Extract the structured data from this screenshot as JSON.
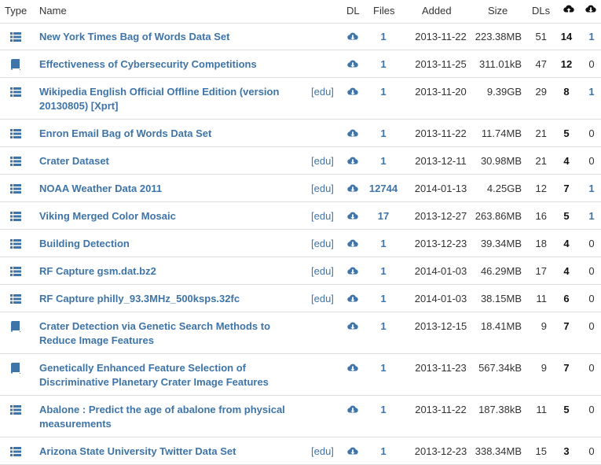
{
  "header": {
    "type": "Type",
    "name": "Name",
    "dl": "DL",
    "files": "Files",
    "added": "Added",
    "size": "Size",
    "dls": "DLs",
    "seeders_icon": "cloud-upload-icon",
    "leechers_icon": "cloud-download-icon"
  },
  "colors": {
    "link": "#3e74a8",
    "border": "#dddddd",
    "text": "#333333"
  },
  "rows": [
    {
      "type": "dataset",
      "name": "New York Times Bag of Words Data Set",
      "edu": "",
      "files": "1",
      "added": "2013-11-22",
      "size": "223.38MB",
      "dls": "51",
      "seeders": "14",
      "leechers": "1"
    },
    {
      "type": "paper",
      "name": "Effectiveness of Cybersecurity Competitions",
      "edu": "",
      "files": "1",
      "added": "2013-11-25",
      "size": "311.01kB",
      "dls": "47",
      "seeders": "12",
      "leechers": "0"
    },
    {
      "type": "dataset",
      "name": "Wikipedia English Official Offline Edition (version 20130805) [Xprt]",
      "edu": "[edu]",
      "files": "1",
      "added": "2013-11-20",
      "size": "9.39GB",
      "dls": "29",
      "seeders": "8",
      "leechers": "1"
    },
    {
      "type": "dataset",
      "name": "Enron Email Bag of Words Data Set",
      "edu": "",
      "files": "1",
      "added": "2013-11-22",
      "size": "11.74MB",
      "dls": "21",
      "seeders": "5",
      "leechers": "0"
    },
    {
      "type": "dataset",
      "name": "Crater Dataset",
      "edu": "[edu]",
      "files": "1",
      "added": "2013-12-11",
      "size": "30.98MB",
      "dls": "21",
      "seeders": "4",
      "leechers": "0"
    },
    {
      "type": "dataset",
      "name": "NOAA Weather Data 2011",
      "edu": "[edu]",
      "files": "12744",
      "added": "2014-01-13",
      "size": "4.25GB",
      "dls": "12",
      "seeders": "7",
      "leechers": "1"
    },
    {
      "type": "dataset",
      "name": "Viking Merged Color Mosaic",
      "edu": "[edu]",
      "files": "17",
      "added": "2013-12-27",
      "size": "263.86MB",
      "dls": "16",
      "seeders": "5",
      "leechers": "1"
    },
    {
      "type": "dataset",
      "name": "Building Detection",
      "edu": "[edu]",
      "files": "1",
      "added": "2013-12-23",
      "size": "39.34MB",
      "dls": "18",
      "seeders": "4",
      "leechers": "0"
    },
    {
      "type": "dataset",
      "name": "RF Capture gsm.dat.bz2",
      "edu": "[edu]",
      "files": "1",
      "added": "2014-01-03",
      "size": "46.29MB",
      "dls": "17",
      "seeders": "4",
      "leechers": "0"
    },
    {
      "type": "dataset",
      "name": "RF Capture philly_93.3MHz_500ksps.32fc",
      "edu": "[edu]",
      "files": "1",
      "added": "2014-01-03",
      "size": "38.15MB",
      "dls": "11",
      "seeders": "6",
      "leechers": "0"
    },
    {
      "type": "paper",
      "name": "Crater Detection via Genetic Search Methods to Reduce Image Features",
      "edu": "",
      "files": "1",
      "added": "2013-12-15",
      "size": "18.41MB",
      "dls": "9",
      "seeders": "7",
      "leechers": "0"
    },
    {
      "type": "paper",
      "name": "Genetically Enhanced Feature Selection of Discriminative Planetary Crater Image Features",
      "edu": "",
      "files": "1",
      "added": "2013-11-23",
      "size": "567.34kB",
      "dls": "9",
      "seeders": "7",
      "leechers": "0"
    },
    {
      "type": "dataset",
      "name": "Abalone : Predict the age of abalone from physical measurements",
      "edu": "",
      "files": "1",
      "added": "2013-11-22",
      "size": "187.38kB",
      "dls": "11",
      "seeders": "5",
      "leechers": "0"
    },
    {
      "type": "dataset",
      "name": "Arizona State University Twitter Data Set",
      "edu": "[edu]",
      "files": "1",
      "added": "2013-12-23",
      "size": "338.34MB",
      "dls": "15",
      "seeders": "3",
      "leechers": "0"
    }
  ]
}
